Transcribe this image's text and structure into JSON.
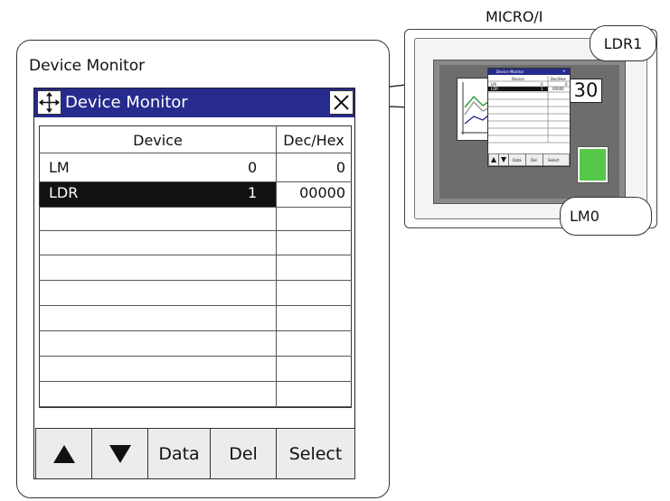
{
  "callout": {
    "title": "Device Monitor"
  },
  "window": {
    "title": "Device Monitor",
    "move_icon": "move-arrows-icon",
    "close_icon": "close-icon"
  },
  "table": {
    "headers": {
      "device": "Device",
      "value": "Dec/Hex"
    },
    "rows": [
      {
        "device": "LM",
        "index": "0",
        "value": "0",
        "selected": false
      },
      {
        "device": "LDR",
        "index": "1",
        "value": "00000",
        "selected": true
      }
    ],
    "empty_row_count": 8
  },
  "buttons": {
    "up": "▲",
    "down": "▼",
    "data": "Data",
    "del": "Del",
    "select": "Select"
  },
  "device": {
    "label": "MICRO/I",
    "display_value": "30",
    "lamp_color": "#55c84a",
    "mini_window": {
      "title": "Device Monitor",
      "header_device": "Device",
      "header_value": "Dec/Hex",
      "row1_device": "LM",
      "row1_index": "0",
      "row1_value": "0",
      "row2_device": "LDR",
      "row2_index": "1",
      "row2_value": "00000",
      "btn_data": "Data",
      "btn_del": "Del",
      "btn_select": "Select"
    }
  },
  "bubbles": {
    "ldr1": "LDR1",
    "lm0": "LM0"
  },
  "colors": {
    "title_bar": "#272b8e",
    "selected_row": "#111111",
    "button_bg": "#ececec"
  }
}
